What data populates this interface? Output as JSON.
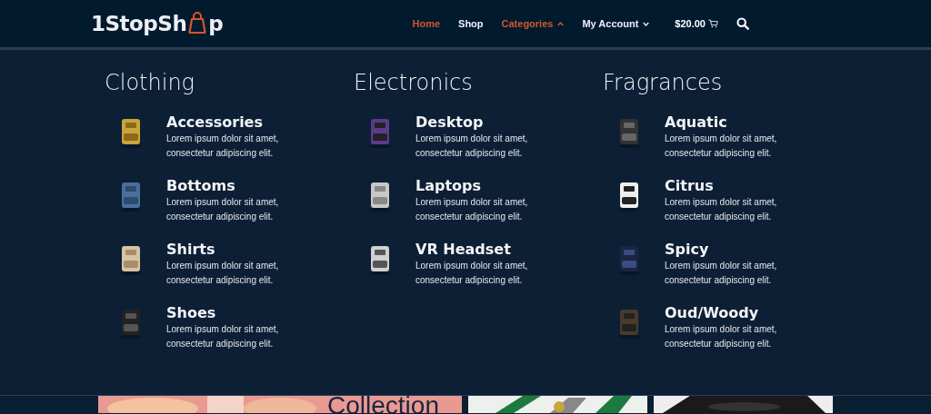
{
  "logo": {
    "before": "1StopSh",
    "after": "p"
  },
  "nav": [
    {
      "kind": "link",
      "label": "Home",
      "selected": true
    },
    {
      "kind": "link",
      "label": "Shop",
      "selected": false
    },
    {
      "kind": "dropdown",
      "label": "Categories",
      "selected": true,
      "expanded": true
    },
    {
      "kind": "dropdown",
      "label": "My Account",
      "selected": false,
      "expanded": false
    }
  ],
  "cart": {
    "total": "$20.00"
  },
  "menu": [
    {
      "heading": "Clothing",
      "items": [
        {
          "title": "Accessories",
          "description": "Lorem ipsum dolor sit amet, consectetur adipiscing elit.",
          "kind": "picture"
        },
        {
          "title": "Bottoms",
          "description": "Lorem ipsum dolor sit amet, consectetur adipiscing elit.",
          "kind": "picture"
        },
        {
          "title": "Shirts",
          "description": "Lorem ipsum dolor sit amet, consectetur adipiscing elit.",
          "kind": "picture"
        },
        {
          "title": "Shoes",
          "description": "Lorem ipsum dolor sit amet, consectetur adipiscing elit.",
          "kind": "picture"
        }
      ]
    },
    {
      "heading": "Electronics",
      "items": [
        {
          "title": "Desktop",
          "description": "Lorem ipsum dolor sit amet, consectetur adipiscing elit.",
          "kind": "picture"
        },
        {
          "title": "Laptops",
          "description": "Lorem ipsum dolor sit amet, consectetur adipiscing elit.",
          "kind": "picture"
        },
        {
          "title": "VR Headset",
          "description": "Lorem ipsum dolor sit amet, consectetur adipiscing elit.",
          "kind": "picture"
        }
      ]
    },
    {
      "heading": "Fragrances",
      "items": [
        {
          "title": "Aquatic",
          "description": "Lorem ipsum dolor sit amet, consectetur adipiscing elit.",
          "kind": "picture"
        },
        {
          "title": "Citrus",
          "description": "Lorem ipsum dolor sit amet, consectetur adipiscing elit.",
          "kind": "picture"
        },
        {
          "title": "Spicy",
          "description": "Lorem ipsum dolor sit amet, consectetur adipiscing elit.",
          "kind": "picture"
        },
        {
          "title": "Oud/Woody",
          "description": "Lorem ipsum dolor sit amet, consectetur adipiscing elit.",
          "kind": "picture"
        }
      ]
    }
  ],
  "banner": {
    "title": "Collection"
  }
}
